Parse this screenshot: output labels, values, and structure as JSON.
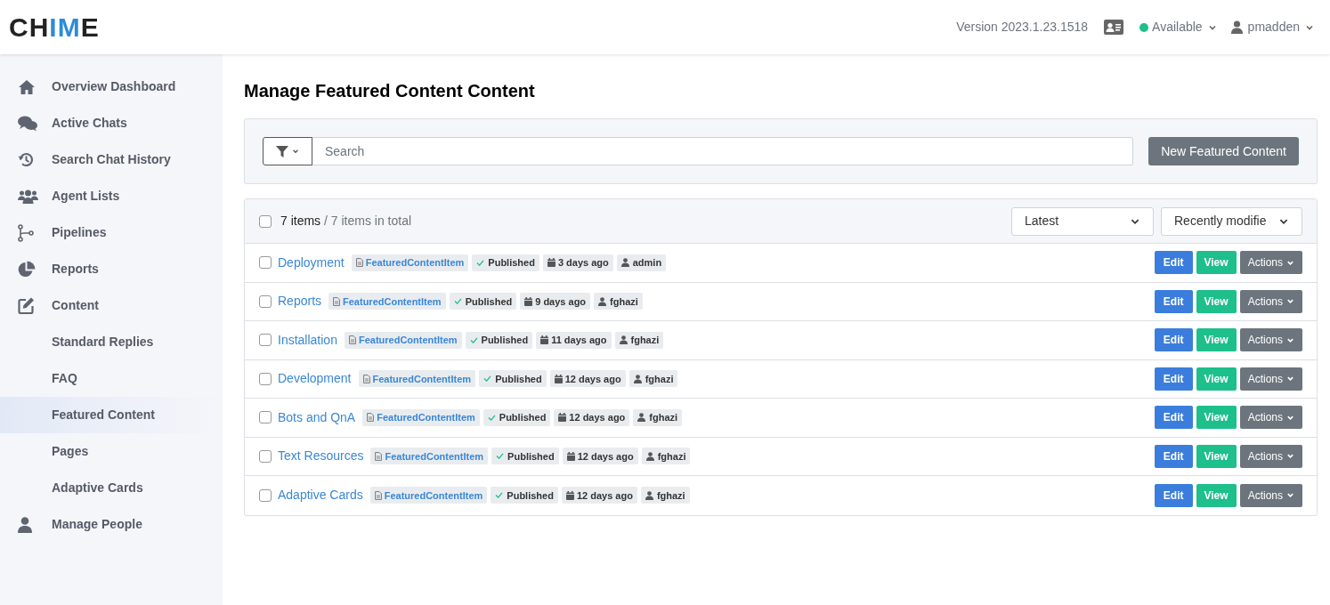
{
  "logo": "CHIME",
  "header": {
    "version": "Version 2023.1.23.1518",
    "status": {
      "label": "Available",
      "color": "#1dbf8a"
    },
    "user": "pmadden"
  },
  "sidebar": {
    "items": [
      {
        "label": "Overview Dashboard",
        "selected": false
      },
      {
        "label": "Active Chats",
        "selected": false
      },
      {
        "label": "Search Chat History",
        "selected": false
      },
      {
        "label": "Agent Lists",
        "selected": false
      },
      {
        "label": "Pipelines",
        "selected": false
      },
      {
        "label": "Reports",
        "selected": false
      },
      {
        "label": "Content",
        "selected": false,
        "children": [
          {
            "label": "Standard Replies",
            "selected": false
          },
          {
            "label": "FAQ",
            "selected": false
          },
          {
            "label": "Featured Content",
            "selected": true
          },
          {
            "label": "Pages",
            "selected": false
          },
          {
            "label": "Adaptive Cards",
            "selected": false
          }
        ]
      },
      {
        "label": "Manage People",
        "selected": false
      }
    ]
  },
  "page_title": "Manage Featured Content Content",
  "search": {
    "placeholder": "Search"
  },
  "new_button": "New Featured Content",
  "list": {
    "select_all_checked": false,
    "count": "7 items",
    "total": "/ 7 items in total",
    "sort_order": "Latest",
    "sort_field": "Recently modifie",
    "rows": [
      {
        "title": "Deployment",
        "type": "FeaturedContentItem",
        "status": "Published",
        "date": "3 days ago",
        "author": "admin",
        "checked": false,
        "buttons": {
          "edit": "Edit",
          "view": "View",
          "actions": "Actions"
        }
      },
      {
        "title": "Reports",
        "type": "FeaturedContentItem",
        "status": "Published",
        "date": "9 days ago",
        "author": "fghazi",
        "checked": false,
        "buttons": {
          "edit": "Edit",
          "view": "View",
          "actions": "Actions"
        }
      },
      {
        "title": "Installation",
        "type": "FeaturedContentItem",
        "status": "Published",
        "date": "11 days ago",
        "author": "fghazi",
        "checked": false,
        "buttons": {
          "edit": "Edit",
          "view": "View",
          "actions": "Actions"
        }
      },
      {
        "title": "Development",
        "type": "FeaturedContentItem",
        "status": "Published",
        "date": "12 days ago",
        "author": "fghazi",
        "checked": false,
        "buttons": {
          "edit": "Edit",
          "view": "View",
          "actions": "Actions"
        }
      },
      {
        "title": "Bots and QnA",
        "type": "FeaturedContentItem",
        "status": "Published",
        "date": "12 days ago",
        "author": "fghazi",
        "checked": false,
        "buttons": {
          "edit": "Edit",
          "view": "View",
          "actions": "Actions"
        }
      },
      {
        "title": "Text Resources",
        "type": "FeaturedContentItem",
        "status": "Published",
        "date": "12 days ago",
        "author": "fghazi",
        "checked": false,
        "buttons": {
          "edit": "Edit",
          "view": "View",
          "actions": "Actions"
        }
      },
      {
        "title": "Adaptive Cards",
        "type": "FeaturedContentItem",
        "status": "Published",
        "date": "12 days ago",
        "author": "fghazi",
        "checked": false,
        "buttons": {
          "edit": "Edit",
          "view": "View",
          "actions": "Actions"
        }
      }
    ]
  }
}
